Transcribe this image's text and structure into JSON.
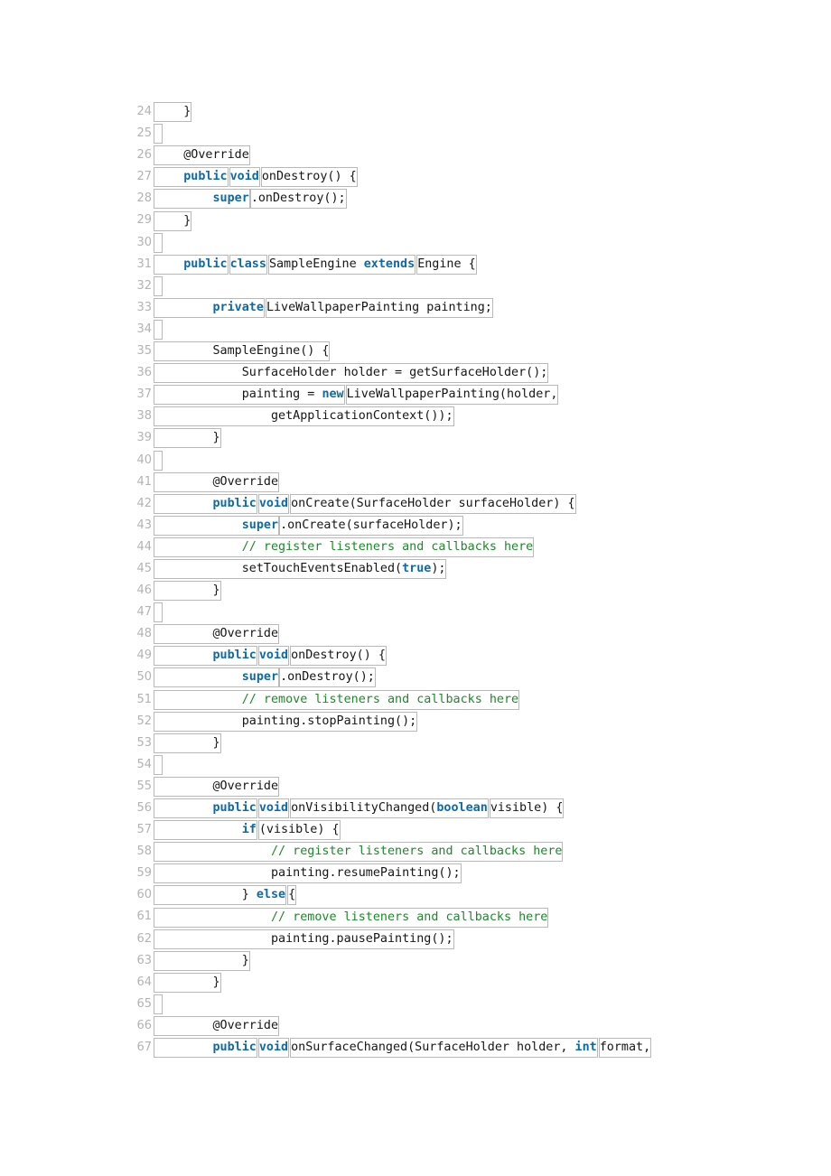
{
  "document": {
    "kind": "source-code-listing",
    "language": "Java",
    "colors": {
      "keyword": "#0d6aa8",
      "comment": "#1a8a28",
      "plain": "#161616",
      "line_number": "#b3b3b3",
      "token_box_border": "#b9b9b9",
      "page_background": "#ffffff"
    },
    "first_line_number": 24,
    "last_line_number": 67
  },
  "code_lines": [
    {
      "n": "24",
      "tokens": [
        {
          "t": "    }",
          "c": "pl"
        }
      ]
    },
    {
      "n": "25",
      "tokens": [
        {
          "t": " ",
          "c": "pl"
        }
      ]
    },
    {
      "n": "26",
      "tokens": [
        {
          "t": "    @Override",
          "c": "pl"
        }
      ]
    },
    {
      "n": "27",
      "tokens": [
        {
          "t": "    public",
          "c": "kw"
        },
        {
          "t": "void",
          "c": "kw"
        },
        {
          "t": "onDestroy() {",
          "c": "pl"
        }
      ]
    },
    {
      "n": "28",
      "tokens": [
        {
          "t": "        super",
          "c": "kw"
        },
        {
          "t": ".onDestroy();",
          "c": "pl",
          "join": true
        }
      ]
    },
    {
      "n": "29",
      "tokens": [
        {
          "t": "    }",
          "c": "pl"
        }
      ]
    },
    {
      "n": "30",
      "tokens": [
        {
          "t": " ",
          "c": "pl"
        }
      ]
    },
    {
      "n": "31",
      "tokens": [
        {
          "t": "    public",
          "c": "kw"
        },
        {
          "t": "class",
          "c": "kw"
        },
        {
          "t": "SampleEngine ",
          "c": "pl",
          "suffix": "extends",
          "suffix_class": "kw"
        },
        {
          "t": "Engine {",
          "c": "pl"
        }
      ]
    },
    {
      "n": "32",
      "tokens": [
        {
          "t": " ",
          "c": "pl"
        }
      ]
    },
    {
      "n": "33",
      "tokens": [
        {
          "t": "        private",
          "c": "kw"
        },
        {
          "t": "LiveWallpaperPainting painting;",
          "c": "pl"
        }
      ]
    },
    {
      "n": "34",
      "tokens": [
        {
          "t": " ",
          "c": "pl"
        }
      ]
    },
    {
      "n": "35",
      "tokens": [
        {
          "t": "        SampleEngine() {",
          "c": "pl"
        }
      ]
    },
    {
      "n": "36",
      "tokens": [
        {
          "t": "            SurfaceHolder holder = getSurfaceHolder();",
          "c": "pl"
        }
      ]
    },
    {
      "n": "37",
      "tokens": [
        {
          "t": "            painting = ",
          "c": "pl",
          "suffix": "new",
          "suffix_class": "kw"
        },
        {
          "t": "LiveWallpaperPainting(holder,",
          "c": "pl"
        }
      ]
    },
    {
      "n": "38",
      "tokens": [
        {
          "t": "                getApplicationContext());",
          "c": "pl"
        }
      ]
    },
    {
      "n": "39",
      "tokens": [
        {
          "t": "        }",
          "c": "pl"
        }
      ]
    },
    {
      "n": "40",
      "tokens": [
        {
          "t": " ",
          "c": "pl"
        }
      ]
    },
    {
      "n": "41",
      "tokens": [
        {
          "t": "        @Override",
          "c": "pl"
        }
      ]
    },
    {
      "n": "42",
      "tokens": [
        {
          "t": "        public",
          "c": "kw"
        },
        {
          "t": "void",
          "c": "kw"
        },
        {
          "t": "onCreate(SurfaceHolder surfaceHolder) {",
          "c": "pl"
        }
      ]
    },
    {
      "n": "43",
      "tokens": [
        {
          "t": "            super",
          "c": "kw"
        },
        {
          "t": ".onCreate(surfaceHolder);",
          "c": "pl",
          "join": true
        }
      ]
    },
    {
      "n": "44",
      "tokens": [
        {
          "t": "            // register listeners and callbacks here",
          "c": "cm"
        }
      ]
    },
    {
      "n": "45",
      "tokens": [
        {
          "t": "            setTouchEventsEnabled(",
          "c": "pl",
          "suffix": "true",
          "suffix_class": "kw",
          "tail": ");"
        }
      ]
    },
    {
      "n": "46",
      "tokens": [
        {
          "t": "        }",
          "c": "pl"
        }
      ]
    },
    {
      "n": "47",
      "tokens": [
        {
          "t": " ",
          "c": "pl"
        }
      ]
    },
    {
      "n": "48",
      "tokens": [
        {
          "t": "        @Override",
          "c": "pl"
        }
      ]
    },
    {
      "n": "49",
      "tokens": [
        {
          "t": "        public",
          "c": "kw"
        },
        {
          "t": "void",
          "c": "kw"
        },
        {
          "t": "onDestroy() {",
          "c": "pl"
        }
      ]
    },
    {
      "n": "50",
      "tokens": [
        {
          "t": "            super",
          "c": "kw"
        },
        {
          "t": ".onDestroy();",
          "c": "pl",
          "join": true
        }
      ]
    },
    {
      "n": "51",
      "tokens": [
        {
          "t": "            // remove listeners and callbacks here",
          "c": "cm"
        }
      ]
    },
    {
      "n": "52",
      "tokens": [
        {
          "t": "            painting.stopPainting();",
          "c": "pl"
        }
      ]
    },
    {
      "n": "53",
      "tokens": [
        {
          "t": "        }",
          "c": "pl"
        }
      ]
    },
    {
      "n": "54",
      "tokens": [
        {
          "t": " ",
          "c": "pl"
        }
      ]
    },
    {
      "n": "55",
      "tokens": [
        {
          "t": "        @Override",
          "c": "pl"
        }
      ]
    },
    {
      "n": "56",
      "tokens": [
        {
          "t": "        public",
          "c": "kw"
        },
        {
          "t": "void",
          "c": "kw"
        },
        {
          "t": "onVisibilityChanged(",
          "c": "pl",
          "suffix": "boolean",
          "suffix_class": "kw"
        },
        {
          "t": "visible) {",
          "c": "pl"
        }
      ]
    },
    {
      "n": "57",
      "tokens": [
        {
          "t": "            if",
          "c": "kw"
        },
        {
          "t": "(visible) {",
          "c": "pl"
        }
      ]
    },
    {
      "n": "58",
      "tokens": [
        {
          "t": "                // register listeners and callbacks here",
          "c": "cm"
        }
      ]
    },
    {
      "n": "59",
      "tokens": [
        {
          "t": "                painting.resumePainting();",
          "c": "pl"
        }
      ]
    },
    {
      "n": "60",
      "tokens": [
        {
          "t": "            } ",
          "c": "pl",
          "suffix": "else",
          "suffix_class": "kw"
        },
        {
          "t": "{",
          "c": "pl"
        }
      ]
    },
    {
      "n": "61",
      "tokens": [
        {
          "t": "                // remove listeners and callbacks here",
          "c": "cm"
        }
      ]
    },
    {
      "n": "62",
      "tokens": [
        {
          "t": "                painting.pausePainting();",
          "c": "pl"
        }
      ]
    },
    {
      "n": "63",
      "tokens": [
        {
          "t": "            }",
          "c": "pl"
        }
      ]
    },
    {
      "n": "64",
      "tokens": [
        {
          "t": "        }",
          "c": "pl"
        }
      ]
    },
    {
      "n": "65",
      "tokens": [
        {
          "t": " ",
          "c": "pl"
        }
      ]
    },
    {
      "n": "66",
      "tokens": [
        {
          "t": "        @Override",
          "c": "pl"
        }
      ]
    },
    {
      "n": "67",
      "tokens": [
        {
          "t": "        public",
          "c": "kw"
        },
        {
          "t": "void",
          "c": "kw"
        },
        {
          "t": "onSurfaceChanged(SurfaceHolder holder, ",
          "c": "pl",
          "suffix": "int",
          "suffix_class": "kw"
        },
        {
          "t": "format,",
          "c": "pl"
        }
      ]
    }
  ]
}
